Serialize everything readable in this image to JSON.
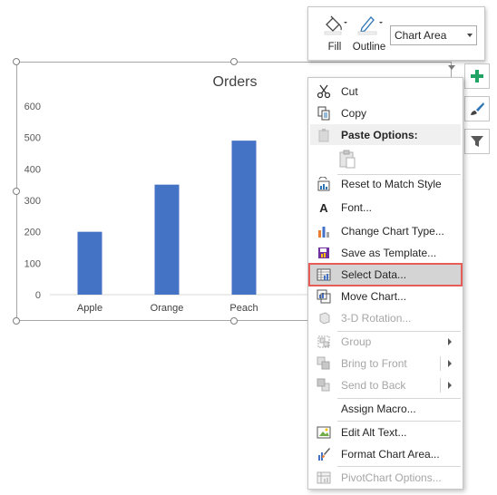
{
  "chart_data": {
    "type": "bar",
    "title": "Orders",
    "categories": [
      "Apple",
      "Orange",
      "Peach"
    ],
    "values": [
      200,
      350,
      490
    ],
    "ylim": [
      0,
      600
    ],
    "yticks": [
      0,
      100,
      200,
      300,
      400,
      500,
      600
    ],
    "series": [
      {
        "values": [
          200,
          350,
          490
        ],
        "color": "#4472c4"
      }
    ],
    "grid": false,
    "legend": "none"
  },
  "mini_toolbar": {
    "fill_label": "Fill",
    "outline_label": "Outline",
    "element_select_value": "Chart Area"
  },
  "side_buttons": [
    "plus-icon",
    "brush-icon",
    "filter-icon"
  ],
  "context_menu": {
    "paste_options_label": "Paste Options:",
    "items": [
      {
        "label": "Cut",
        "icon": "scissors-icon",
        "disabled": false
      },
      {
        "label": "Copy",
        "icon": "copy-icon",
        "disabled": false
      },
      {
        "label": "Reset to Match Style",
        "icon": "reset-style-icon",
        "disabled": false
      },
      {
        "label": "Font...",
        "icon": "font-icon",
        "disabled": false
      },
      {
        "label": "Change Chart Type...",
        "icon": "chart-type-icon",
        "disabled": false
      },
      {
        "label": "Save as Template...",
        "icon": "save-template-icon",
        "disabled": false
      },
      {
        "label": "Select Data...",
        "icon": "select-data-icon",
        "disabled": false,
        "highlighted": true
      },
      {
        "label": "Move Chart...",
        "icon": "move-chart-icon",
        "disabled": false
      },
      {
        "label": "3-D Rotation...",
        "icon": "rotation-3d-icon",
        "disabled": true
      },
      {
        "label": "Group",
        "icon": "group-icon",
        "disabled": true,
        "submenu": true
      },
      {
        "label": "Bring to Front",
        "icon": "bring-front-icon",
        "disabled": true,
        "submenu": true
      },
      {
        "label": "Send to Back",
        "icon": "send-back-icon",
        "disabled": true,
        "submenu": true
      },
      {
        "label": "Assign Macro...",
        "icon": "",
        "disabled": false
      },
      {
        "label": "Edit Alt Text...",
        "icon": "alt-text-icon",
        "disabled": false
      },
      {
        "label": "Format Chart Area...",
        "icon": "format-area-icon",
        "disabled": false
      },
      {
        "label": "PivotChart Options...",
        "icon": "pivot-options-icon",
        "disabled": true
      }
    ]
  },
  "colors": {
    "accent": "#4472c4",
    "highlight_border": "#e85c58",
    "plus_green": "#21a366"
  }
}
